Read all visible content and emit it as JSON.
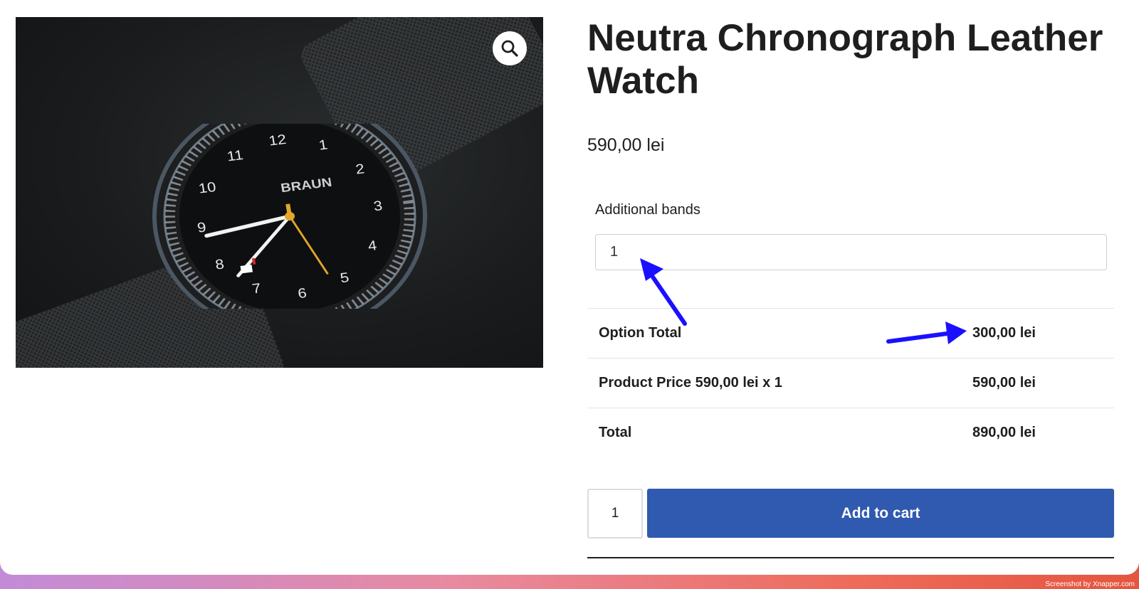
{
  "product": {
    "title": "Neutra Chronograph Leather Watch",
    "price": "590,00 lei",
    "image_icon": "zoom-icon"
  },
  "options": {
    "field_label": "Additional bands",
    "field_value": "1"
  },
  "totals": {
    "rows": [
      {
        "label": "Option Total",
        "value": "300,00 lei"
      },
      {
        "label": "Product Price 590,00 lei x 1",
        "value": "590,00 lei"
      },
      {
        "label": "Total",
        "value": "890,00 lei"
      }
    ]
  },
  "cart": {
    "quantity": "1",
    "add_label": "Add to cart"
  },
  "watch_face": {
    "brand": "BRAUN",
    "numerals": [
      "12",
      "1",
      "2",
      "3",
      "4",
      "5",
      "6",
      "7",
      "8",
      "9",
      "10",
      "11"
    ]
  },
  "colors": {
    "button": "#2f5aaf",
    "annotation_arrow": "#1a10ff"
  },
  "footer": {
    "credit": "Screenshot by Xnapper.com"
  }
}
